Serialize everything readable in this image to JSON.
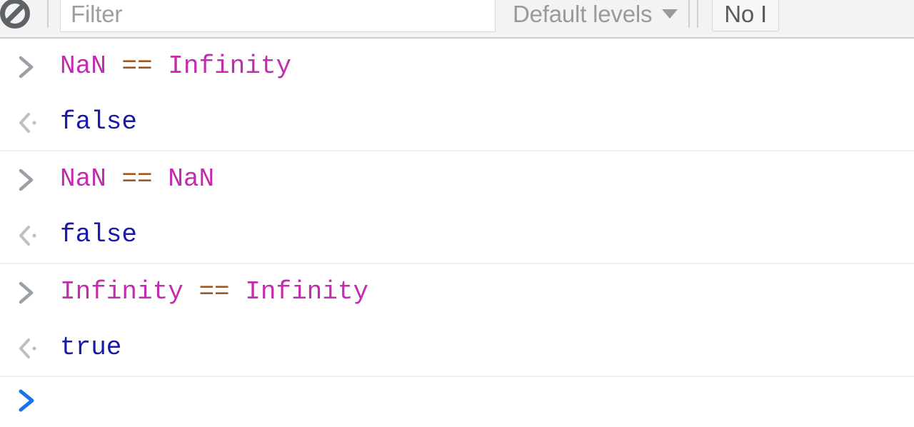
{
  "window": {
    "app": "Chrome DevTools",
    "panel": "Console"
  },
  "toolbar": {
    "clear_icon": "clear-console-icon",
    "filter": {
      "placeholder": "Filter",
      "value": ""
    },
    "levels": {
      "label": "Default levels",
      "caret_icon": "chevron-down-icon"
    },
    "issues": {
      "label": "No I"
    }
  },
  "console": {
    "input_marker": ">",
    "result_marker": "<",
    "entries": [
      {
        "input": {
          "marker_icon": "chevron-right-icon",
          "tokens": [
            {
              "text": "NaN",
              "type": "ident"
            },
            {
              "text": " ",
              "type": "space"
            },
            {
              "text": "==",
              "type": "op"
            },
            {
              "text": " ",
              "type": "space"
            },
            {
              "text": "Infinity",
              "type": "ident"
            }
          ],
          "text": "NaN == Infinity"
        },
        "result": {
          "marker_icon": "chevron-left-dot-icon",
          "value": "false",
          "type": "boolean"
        }
      },
      {
        "input": {
          "marker_icon": "chevron-right-icon",
          "tokens": [
            {
              "text": "NaN",
              "type": "ident"
            },
            {
              "text": " ",
              "type": "space"
            },
            {
              "text": "==",
              "type": "op"
            },
            {
              "text": " ",
              "type": "space"
            },
            {
              "text": "NaN",
              "type": "ident"
            }
          ],
          "text": "NaN == NaN"
        },
        "result": {
          "marker_icon": "chevron-left-dot-icon",
          "value": "false",
          "type": "boolean"
        }
      },
      {
        "input": {
          "marker_icon": "chevron-right-icon",
          "tokens": [
            {
              "text": "Infinity",
              "type": "ident"
            },
            {
              "text": " ",
              "type": "space"
            },
            {
              "text": "==",
              "type": "op"
            },
            {
              "text": " ",
              "type": "space"
            },
            {
              "text": "Infinity",
              "type": "ident"
            }
          ],
          "text": "Infinity == Infinity"
        },
        "result": {
          "marker_icon": "chevron-left-dot-icon",
          "value": "true",
          "type": "boolean"
        }
      }
    ],
    "prompt": {
      "marker_icon": "chevron-right-icon",
      "value": ""
    }
  },
  "colors": {
    "identifier": "#c12dae",
    "operator": "#9c5a25",
    "boolean": "#1a1aa8",
    "prompt_active": "#1a73e8",
    "marker_gray": "#9aa0a6",
    "toolbar_bg": "#f3f3f3",
    "divider": "#f0f0f0",
    "placeholder": "#9e9e9e"
  }
}
